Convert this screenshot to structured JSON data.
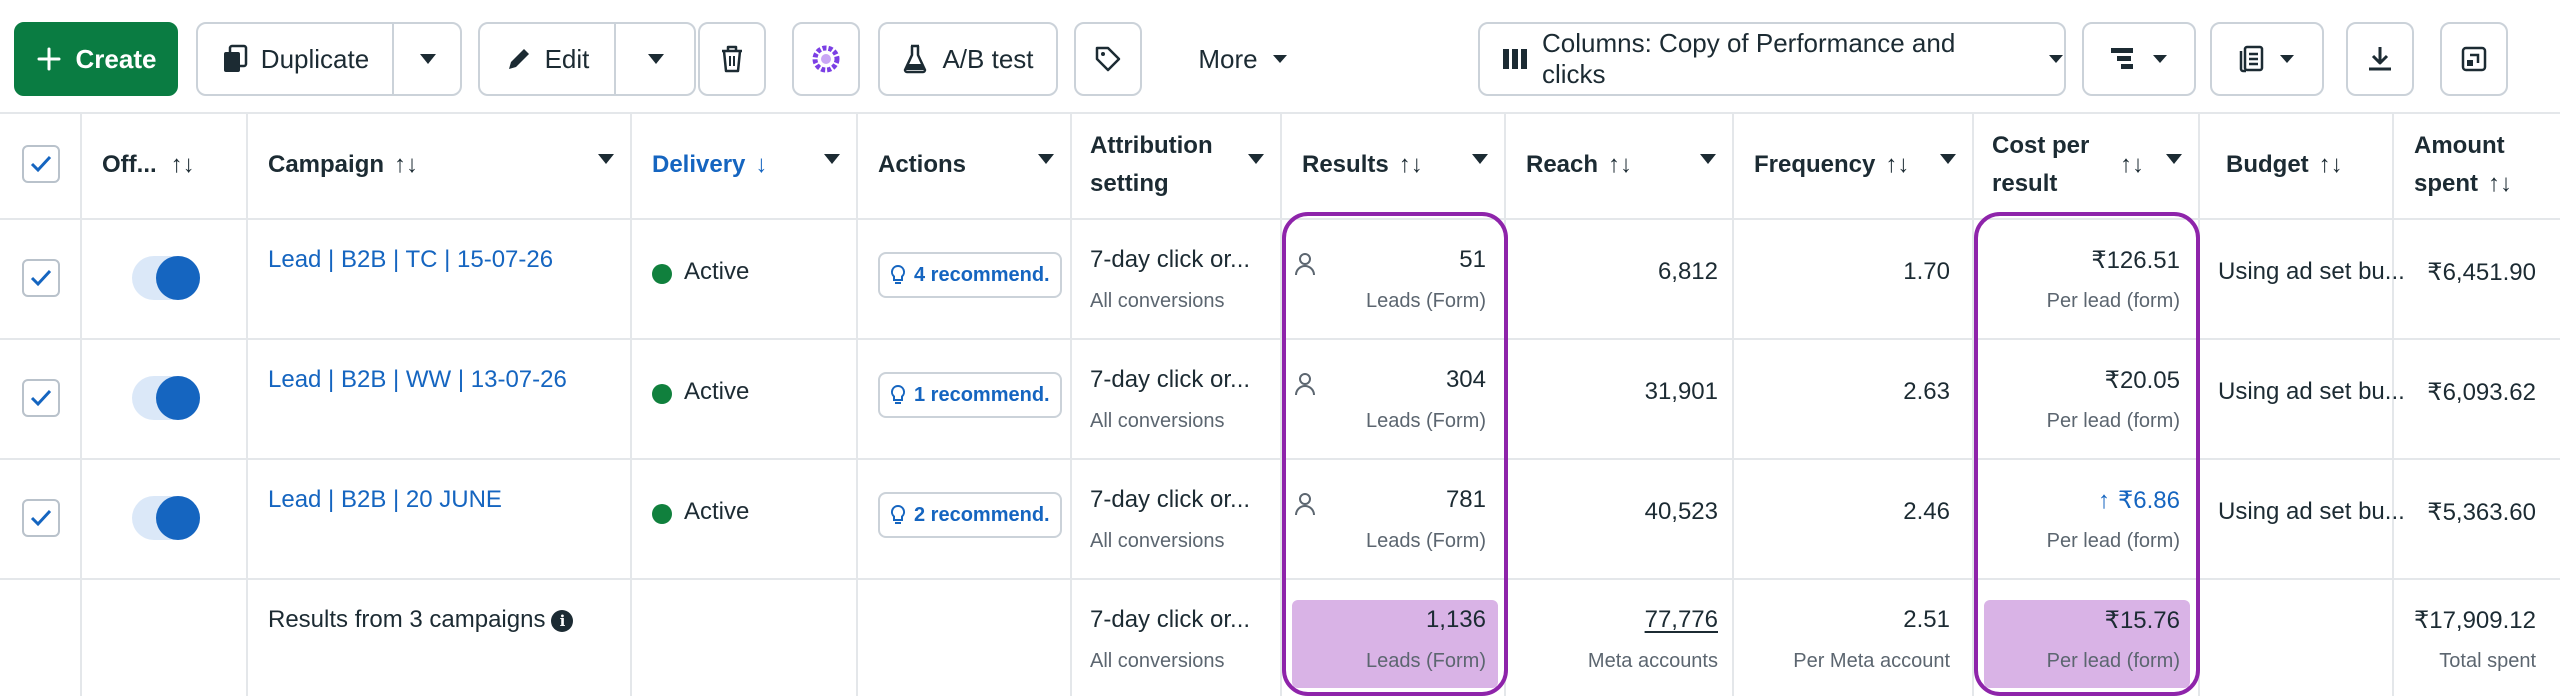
{
  "toolbar": {
    "create_label": "Create",
    "duplicate_label": "Duplicate",
    "edit_label": "Edit",
    "ab_test_label": "A/B test",
    "more_label": "More",
    "columns_label": "Columns: Copy of Performance and clicks"
  },
  "columns": {
    "off": "Off...",
    "campaign": "Campaign",
    "delivery": "Delivery",
    "actions": "Actions",
    "attribution_line1": "Attribution",
    "attribution_line2": "setting",
    "results": "Results",
    "reach": "Reach",
    "frequency": "Frequency",
    "cost_line1": "Cost per",
    "cost_line2": "result",
    "budget": "Budget",
    "amount_line1": "Amount",
    "amount_line2": "spent"
  },
  "rows": [
    {
      "campaign": "Lead | B2B | TC | 15-07-26",
      "delivery": "Active",
      "recommendations": "4 recommend.",
      "attribution": "7-day click or...",
      "attribution_sub": "All conversions",
      "results": "51",
      "results_sub": "Leads (Form)",
      "reach": "6,812",
      "frequency": "1.70",
      "cost": "₹126.51",
      "cost_sub": "Per lead (form)",
      "budget": "Using ad set bu...",
      "amount": "₹6,451.90"
    },
    {
      "campaign": "Lead | B2B | WW | 13-07-26",
      "delivery": "Active",
      "recommendations": "1 recommend.",
      "attribution": "7-day click or...",
      "attribution_sub": "All conversions",
      "results": "304",
      "results_sub": "Leads (Form)",
      "reach": "31,901",
      "frequency": "2.63",
      "cost": "₹20.05",
      "cost_sub": "Per lead (form)",
      "budget": "Using ad set bu...",
      "amount": "₹6,093.62"
    },
    {
      "campaign": "Lead | B2B | 20 JUNE",
      "delivery": "Active",
      "recommendations": "2 recommend.",
      "attribution": "7-day click or...",
      "attribution_sub": "All conversions",
      "results": "781",
      "results_sub": "Leads (Form)",
      "reach": "40,523",
      "frequency": "2.46",
      "cost": "₹6.86",
      "cost_sub": "Per lead (form)",
      "budget": "Using ad set bu...",
      "amount": "₹5,363.60"
    }
  ],
  "summary": {
    "label": "Results from 3 campaigns",
    "attribution": "7-day click or...",
    "attribution_sub": "All conversions",
    "results": "1,136",
    "results_sub": "Leads (Form)",
    "reach": "77,776",
    "reach_sub": "Meta accounts",
    "frequency": "2.51",
    "frequency_sub": "Per Meta account",
    "cost": "₹15.76",
    "cost_sub": "Per lead (form)",
    "amount": "₹17,909.12",
    "amount_sub": "Total spent"
  },
  "colors": {
    "accent_green": "#0a7c42",
    "link_blue": "#1565c0",
    "highlight_frame": "#8e24aa",
    "highlight_fill": "#d9b3e6"
  },
  "icons": [
    "plus-icon",
    "duplicate-icon",
    "pencil-icon",
    "trash-icon",
    "sparkle-icon",
    "flask-icon",
    "tag-icon",
    "columns-icon",
    "breakdown-icon",
    "reports-icon",
    "download-icon",
    "expand-icon",
    "person-icon",
    "lightbulb-icon",
    "info-icon",
    "arrow-up-icon"
  ]
}
